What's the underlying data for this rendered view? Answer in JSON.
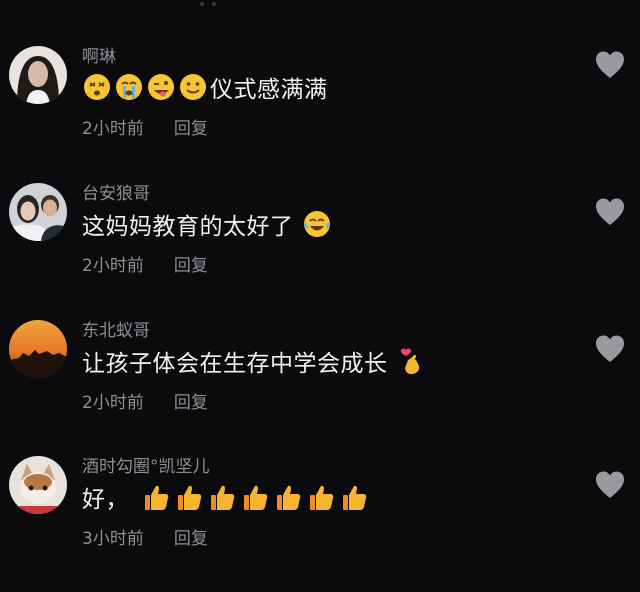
{
  "comments": [
    {
      "username": "啊琳",
      "emoji_prefix": [
        "dizzy-face-emoji",
        "sobbing-face-emoji",
        "winking-tongue-emoji",
        "smiling-face-emoji"
      ],
      "text": "仪式感满满",
      "emoji_suffix": [],
      "time": "2小时前",
      "reply": "回复"
    },
    {
      "username": "台安狼哥",
      "emoji_prefix": [],
      "text": "这妈妈教育的太好了",
      "emoji_suffix": [
        "tears-of-joy-emoji"
      ],
      "time": "2小时前",
      "reply": "回复"
    },
    {
      "username": "东北蚁哥",
      "emoji_prefix": [],
      "text": "让孩子体会在生存中学会成长",
      "emoji_suffix": [
        "finger-heart-emoji"
      ],
      "time": "2小时前",
      "reply": "回复"
    },
    {
      "username": "酒时勾圈°凯坚儿",
      "emoji_prefix": [],
      "text": "好，",
      "emoji_suffix": [
        "thumbs-up-emoji",
        "thumbs-up-emoji",
        "thumbs-up-emoji",
        "thumbs-up-emoji",
        "thumbs-up-emoji",
        "thumbs-up-emoji",
        "thumbs-up-emoji"
      ],
      "time": "3小时前",
      "reply": "回复"
    }
  ],
  "colors": {
    "background": "#0b0b0d",
    "primary_text": "#f2f2f2",
    "secondary_text": "#8e8e93",
    "like_icon": "#9a9a9e"
  }
}
